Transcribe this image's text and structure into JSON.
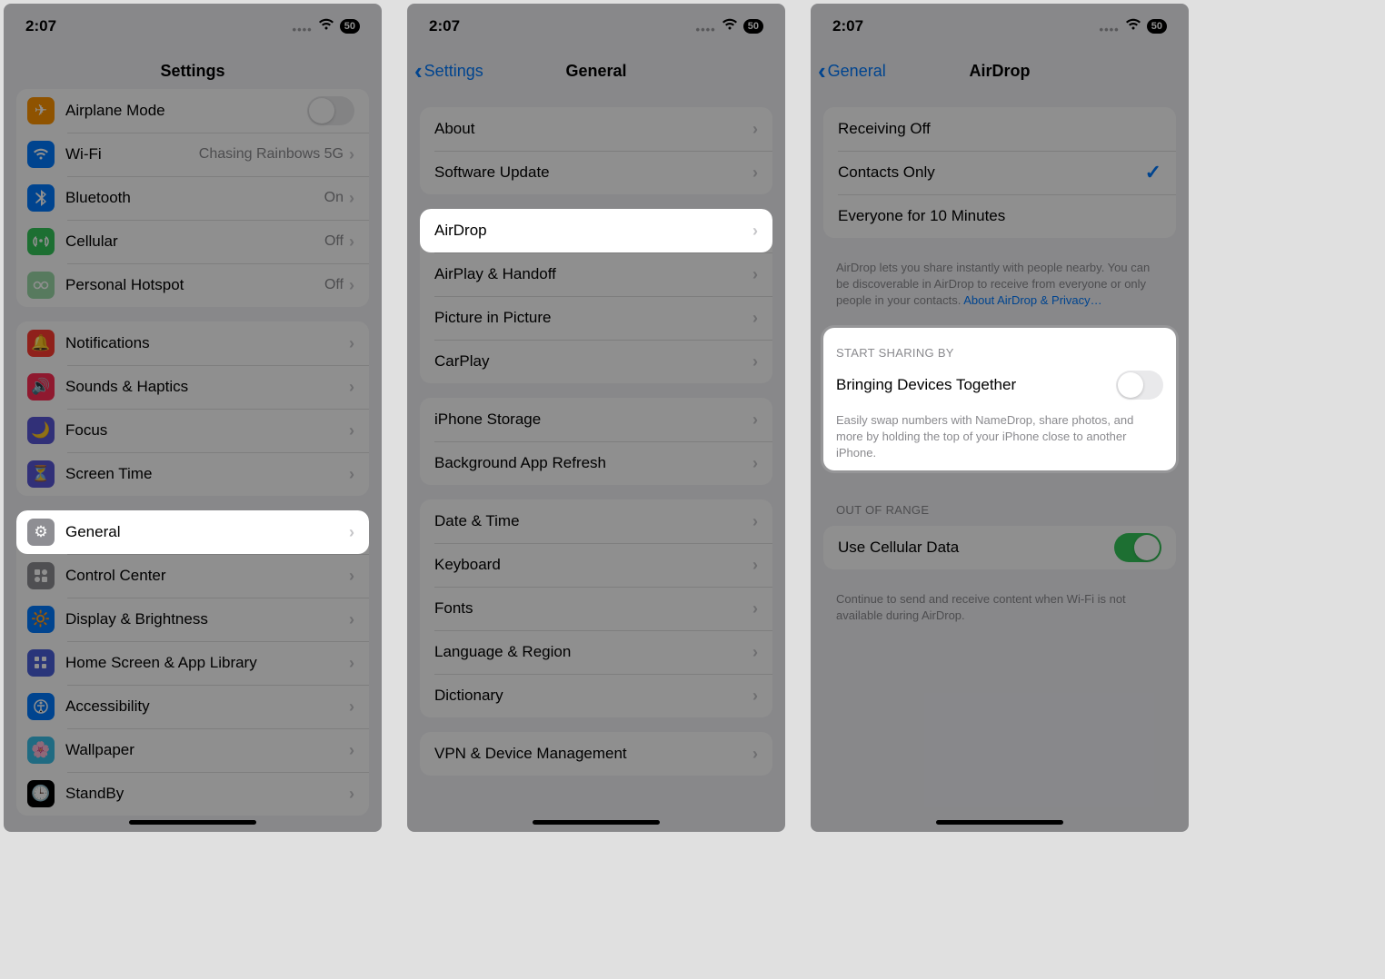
{
  "status": {
    "time": "2:07",
    "battery": "50"
  },
  "screen1": {
    "title": "Settings",
    "group1": [
      {
        "icon": "airplane-icon",
        "color": "#ff9500",
        "label": "Airplane Mode",
        "type": "toggle",
        "toggle": false
      },
      {
        "icon": "wifi-icon",
        "color": "#007aff",
        "label": "Wi-Fi",
        "value": "Chasing Rainbows 5G"
      },
      {
        "icon": "bluetooth-icon",
        "color": "#007aff",
        "label": "Bluetooth",
        "value": "On"
      },
      {
        "icon": "cellular-icon",
        "color": "#34c759",
        "label": "Cellular",
        "value": "Off"
      },
      {
        "icon": "hotspot-icon",
        "color": "#7fcf90",
        "label": "Personal Hotspot",
        "value": "Off"
      }
    ],
    "group2": [
      {
        "icon": "notifications-icon",
        "color": "#ff3b30",
        "label": "Notifications"
      },
      {
        "icon": "sounds-icon",
        "color": "#ff2d55",
        "label": "Sounds & Haptics"
      },
      {
        "icon": "focus-icon",
        "color": "#5856d6",
        "label": "Focus"
      },
      {
        "icon": "screentime-icon",
        "color": "#5856d6",
        "label": "Screen Time"
      }
    ],
    "group3": [
      {
        "icon": "gear-icon",
        "color": "#8e8e93",
        "label": "General",
        "highlight": true
      },
      {
        "icon": "control-center-icon",
        "color": "#8e8e93",
        "label": "Control Center"
      },
      {
        "icon": "display-icon",
        "color": "#007aff",
        "label": "Display & Brightness"
      },
      {
        "icon": "home-screen-icon",
        "color": "#4a5fd9",
        "label": "Home Screen & App Library"
      },
      {
        "icon": "accessibility-icon",
        "color": "#007aff",
        "label": "Accessibility"
      },
      {
        "icon": "wallpaper-icon",
        "color": "#39bfe8",
        "label": "Wallpaper"
      },
      {
        "icon": "standby-icon",
        "color": "#000000",
        "label": "StandBy"
      }
    ]
  },
  "screen2": {
    "back": "Settings",
    "title": "General",
    "group1": [
      {
        "label": "About"
      },
      {
        "label": "Software Update"
      }
    ],
    "group2": [
      {
        "label": "AirDrop",
        "highlight": true
      },
      {
        "label": "AirPlay & Handoff"
      },
      {
        "label": "Picture in Picture"
      },
      {
        "label": "CarPlay"
      }
    ],
    "group3": [
      {
        "label": "iPhone Storage"
      },
      {
        "label": "Background App Refresh"
      }
    ],
    "group4": [
      {
        "label": "Date & Time"
      },
      {
        "label": "Keyboard"
      },
      {
        "label": "Fonts"
      },
      {
        "label": "Language & Region"
      },
      {
        "label": "Dictionary"
      }
    ],
    "group5": [
      {
        "label": "VPN & Device Management"
      }
    ]
  },
  "screen3": {
    "back": "General",
    "title": "AirDrop",
    "receiving": {
      "options": [
        {
          "label": "Receiving Off",
          "selected": false
        },
        {
          "label": "Contacts Only",
          "selected": true
        },
        {
          "label": "Everyone for 10 Minutes",
          "selected": false
        }
      ],
      "footer": "AirDrop lets you share instantly with people nearby. You can be discoverable in AirDrop to receive from everyone or only people in your contacts. ",
      "footer_link": "About AirDrop & Privacy…"
    },
    "sharing": {
      "header": "START SHARING BY",
      "row_label": "Bringing Devices Together",
      "toggle": false,
      "footer": "Easily swap numbers with NameDrop, share photos, and more by holding the top of your iPhone close to another iPhone."
    },
    "range": {
      "header": "OUT OF RANGE",
      "row_label": "Use Cellular Data",
      "toggle": true,
      "footer": "Continue to send and receive content when Wi-Fi is not available during AirDrop."
    }
  }
}
